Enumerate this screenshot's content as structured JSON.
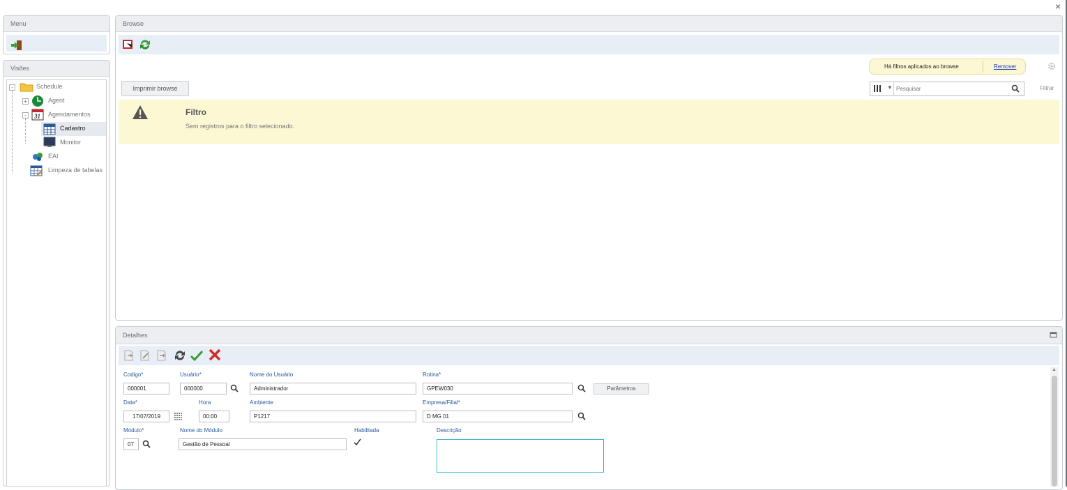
{
  "window": {
    "close": "×"
  },
  "menu": {
    "title": "Menu"
  },
  "visoes": {
    "title": "Visões",
    "tree": [
      {
        "label": "Schedule",
        "expander": "-"
      },
      {
        "label": "Agent",
        "expander": "+"
      },
      {
        "label": "Agendamentos",
        "expander": "-"
      },
      {
        "label": "Cadastro"
      },
      {
        "label": "Monitor"
      },
      {
        "label": "EAI"
      },
      {
        "label": "Limpeza de tabelas"
      }
    ]
  },
  "browse": {
    "title": "Browse",
    "filter_notice": "Há filtros aplicados ao browse",
    "remove_link": "Remover",
    "print_button": "Imprimir browse",
    "search_placeholder": "Pesquisar",
    "filter_link": "Filtrar",
    "alert": {
      "title": "Filtro",
      "message": "Sem registros para o filtro selecionado."
    }
  },
  "details": {
    "title": "Detalhes",
    "fields": {
      "codigo": {
        "label": "Codigo*",
        "value": "000001"
      },
      "usuario": {
        "label": "Usuário*",
        "value": "000000"
      },
      "nome_usuario": {
        "label": "Nome do Usuário",
        "value": "Administrador"
      },
      "rotina": {
        "label": "Rotina*",
        "value": "GPEW030"
      },
      "parametros_button": "Parâmetros",
      "data": {
        "label": "Data*",
        "value": "17/07/2019"
      },
      "hora": {
        "label": "Hora",
        "value": "00:00"
      },
      "ambiente": {
        "label": "Ambiente",
        "value": "P1217"
      },
      "empresa": {
        "label": "Empresa/Filial*",
        "value": "D MG 01"
      },
      "modulo": {
        "label": "Módulo*",
        "value": "07"
      },
      "nome_modulo": {
        "label": "Nome do Módulo",
        "value": "Gestão de Pessoal"
      },
      "habilitada": {
        "label": "Habilitada",
        "checked": true
      },
      "descricao": {
        "label": "Descrição",
        "value": ""
      }
    }
  },
  "colors": {
    "accent_blue": "#2a5a9a",
    "alert_bg": "#fdf8d4",
    "toolbar_bg": "#e8eef5",
    "focus_border": "#3fb4c8"
  }
}
